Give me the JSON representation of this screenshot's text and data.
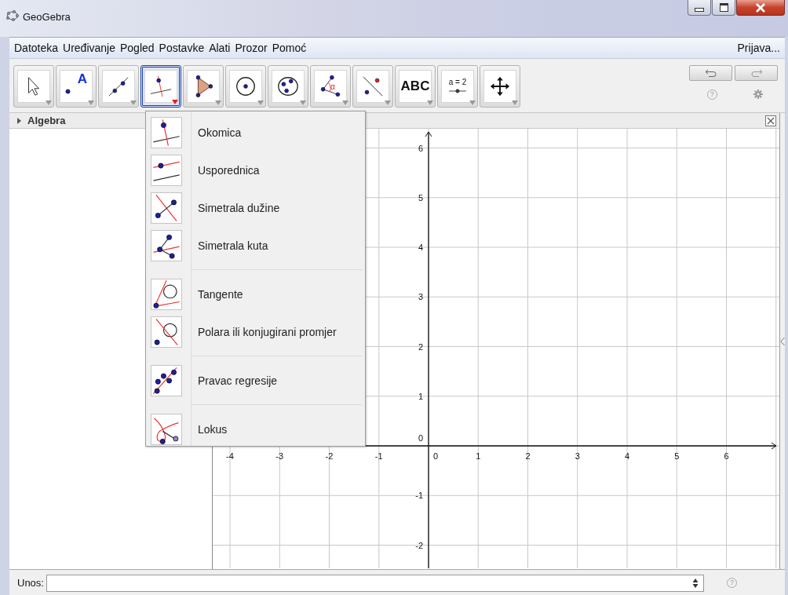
{
  "window": {
    "title": "GeoGebra"
  },
  "menu_bar": {
    "items": [
      "Datoteka",
      "Uređivanje",
      "Pogled",
      "Postavke",
      "Alati",
      "Prozor",
      "Pomoć"
    ],
    "login": "Prijava..."
  },
  "toolbar": {
    "tools": [
      {
        "kind": "move",
        "selected": false
      },
      {
        "kind": "point",
        "label": "A",
        "selected": false
      },
      {
        "kind": "line",
        "selected": false
      },
      {
        "kind": "perpendicular",
        "selected": true
      },
      {
        "kind": "polygon",
        "selected": false
      },
      {
        "kind": "circle",
        "selected": false
      },
      {
        "kind": "conic",
        "selected": false
      },
      {
        "kind": "angle",
        "label": "α",
        "selected": false
      },
      {
        "kind": "reflect",
        "selected": false
      },
      {
        "kind": "text",
        "label": "ABC",
        "selected": false
      },
      {
        "kind": "slider",
        "label": "a = 2",
        "selected": false
      },
      {
        "kind": "move-view",
        "selected": false
      }
    ],
    "help": "?"
  },
  "tool_menu": {
    "groups": [
      [
        {
          "kind": "perpendicular",
          "label": "Okomica"
        },
        {
          "kind": "parallel",
          "label": "Usporednica"
        },
        {
          "kind": "bisector",
          "label": "Simetrala dužine"
        },
        {
          "kind": "angle-bisector",
          "label": "Simetrala kuta"
        }
      ],
      [
        {
          "kind": "tangents",
          "label": "Tangente"
        },
        {
          "kind": "polar",
          "label": "Polara ili konjugirani promjer"
        }
      ],
      [
        {
          "kind": "regression",
          "label": "Pravac regresije"
        }
      ],
      [
        {
          "kind": "locus",
          "label": "Lokus"
        }
      ]
    ]
  },
  "algebra_view": {
    "title": "Algebra",
    "expanded": false
  },
  "graphics_view": {
    "x_labels": [
      "-4",
      "-3",
      "-2",
      "-1",
      "0",
      "1",
      "2",
      "3",
      "4",
      "5",
      "6"
    ],
    "y_labels": [
      "6",
      "5",
      "4",
      "3",
      "2",
      "1",
      "0",
      "-1",
      "-2"
    ]
  },
  "input_bar": {
    "label": "Unos:",
    "help": "?"
  }
}
